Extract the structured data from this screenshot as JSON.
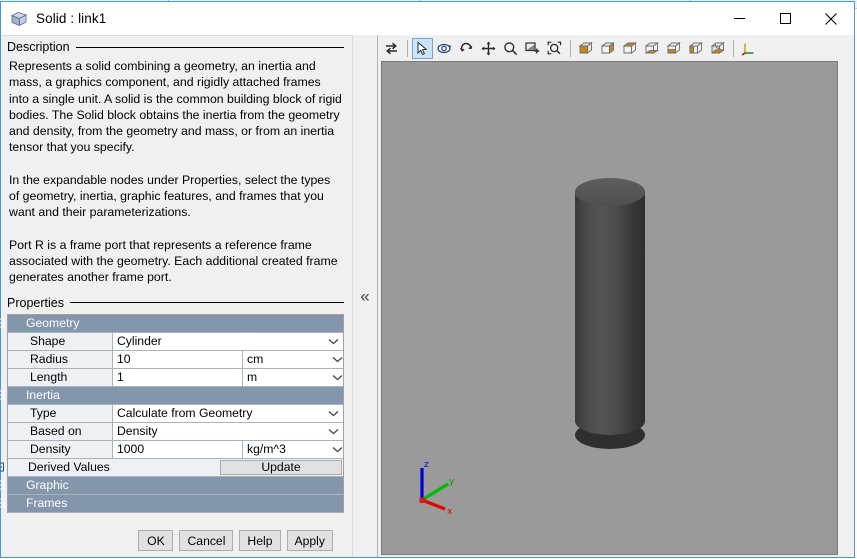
{
  "window": {
    "title": "Solid : link1",
    "icon": "cube-icon",
    "controls": {
      "minimize": "—",
      "maximize": "☐",
      "close": "✕"
    }
  },
  "left_panel": {
    "description_label": "Description",
    "description_paragraphs": [
      "Represents a solid combining a geometry, an inertia and mass, a graphics component, and rigidly attached frames into a single unit. A solid is the common building block of rigid bodies. The Solid block obtains the inertia from the geometry and density, from the geometry and mass, or from an inertia tensor that you specify.",
      "In the expandable nodes under Properties, select the types of geometry, inertia, graphic features, and frames that you want and their parameterizations.",
      "Port R is a frame port that represents a reference frame associated with the geometry. Each additional created frame generates another frame port."
    ],
    "properties_label": "Properties",
    "sections": [
      {
        "name": "Geometry",
        "expanded": true,
        "rows": [
          {
            "name": "Shape",
            "value": "Cylinder",
            "unit": ""
          },
          {
            "name": "Radius",
            "value": "10",
            "unit": "cm"
          },
          {
            "name": "Length",
            "value": "1",
            "unit": "m"
          }
        ]
      },
      {
        "name": "Inertia",
        "expanded": true,
        "rows": [
          {
            "name": "Type",
            "value": "Calculate from Geometry",
            "unit": ""
          },
          {
            "name": "Based on",
            "value": "Density",
            "unit": ""
          },
          {
            "name": "Density",
            "value": "1000",
            "unit": "kg/m^3"
          }
        ]
      }
    ],
    "derived_values": {
      "label": "Derived Values",
      "button": "Update",
      "expanded": false
    },
    "collapsed_sections": [
      {
        "name": "Graphic"
      },
      {
        "name": "Frames"
      }
    ],
    "buttons": [
      {
        "label": "OK"
      },
      {
        "label": "Cancel"
      },
      {
        "label": "Help"
      },
      {
        "label": "Apply"
      }
    ]
  },
  "splitter": {
    "collapse_glyph": "«"
  },
  "viewer": {
    "toolbar_group_1": [
      {
        "icon": "swap-arrows-icon",
        "active": false
      },
      {
        "icon": "select-cursor-icon",
        "active": true
      },
      {
        "icon": "orbit-icon",
        "active": false
      },
      {
        "icon": "rotate-icon",
        "active": false
      },
      {
        "icon": "pan-icon",
        "active": false
      },
      {
        "icon": "zoom-icon",
        "active": false
      },
      {
        "icon": "zoom-window-icon",
        "active": false
      },
      {
        "icon": "fit-to-view-icon",
        "active": false
      }
    ],
    "toolbar_group_2": [
      {
        "icon": "view-front-icon"
      },
      {
        "icon": "view-back-icon"
      },
      {
        "icon": "view-top-icon"
      },
      {
        "icon": "view-bottom-icon"
      },
      {
        "icon": "view-left-icon"
      },
      {
        "icon": "view-right-icon"
      },
      {
        "icon": "view-isometric-icon"
      }
    ],
    "toolbar_group_3": [
      {
        "icon": "coordinate-axes-icon"
      }
    ],
    "scene": {
      "shape": "cylinder",
      "body_color": "#444444",
      "background_color": "#9a9a9a"
    },
    "triad": {
      "x_label": "x",
      "y_label": "y",
      "z_label": "z",
      "x_color": "#e00000",
      "y_color": "#00c000",
      "z_color": "#0000e0"
    }
  }
}
